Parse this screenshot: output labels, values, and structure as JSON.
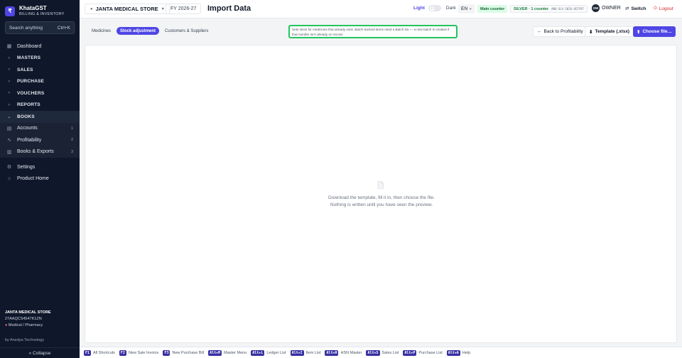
{
  "brand": {
    "logo_glyph": "₹",
    "name": "KhataGST",
    "subtitle": "BILLING & INVENTORY"
  },
  "search": {
    "placeholder": "Search anything",
    "shortcut": "Ctrl+K"
  },
  "nav": {
    "dashboard": "Dashboard",
    "masters": "MASTERS",
    "sales": "SALES",
    "purchase": "PURCHASE",
    "vouchers": "VOUCHERS",
    "reports": "REPORTS",
    "books": "BOOKS",
    "accounts": {
      "label": "Accounts",
      "count": "1"
    },
    "profitability": {
      "label": "Profitability",
      "count": "2"
    },
    "books_exports": {
      "label": "Books & Exports",
      "count": "3"
    },
    "settings": "Settings",
    "product_home": "Product Home"
  },
  "store_info": {
    "name": "JANTA MEDICAL STORE",
    "gstin": "27AAQCS4547K1ZN",
    "type": "Medical / Pharmacy"
  },
  "by_line": "by Anedya Technology",
  "collapse_label": "« Collapse",
  "topbar": {
    "store": "JANTA MEDICAL STORE",
    "fy": "FY 2026-27",
    "title": "Import Data",
    "theme_light": "Light",
    "theme_dark": "Dark",
    "lang": "EN",
    "counter_badge": "Main counter",
    "license_tier": "SILVER · 1 counter",
    "license_key": "ANO-SLV-2026-4E7F97",
    "avatar": "OW",
    "role": "OWNER",
    "switch": "Switch",
    "logout": "Logout"
  },
  "tabs": [
    "Medicines",
    "Stock adjustment",
    "Customers & Suppliers"
  ],
  "info_text": "Sets stock for medicines that already exist. Batch-tracked items need a Batch No — a new batch is created if that number isn't already on record.",
  "actions": {
    "back": "Back to Profitability",
    "template": "Template (.xlsx)",
    "choose": "Choose file…"
  },
  "empty": {
    "line1": "Download the template, fill it in, then choose the file.",
    "line2": "Nothing is written until you have seen the preview."
  },
  "shortcuts": [
    {
      "key": "F1",
      "label": "All Shortcuts"
    },
    {
      "key": "F2",
      "label": "New Sale Invoice"
    },
    {
      "key": "F3",
      "label": "New Purchase Bill"
    },
    {
      "key": "Alt+M",
      "label": "Master Menu"
    },
    {
      "key": "Alt+L",
      "label": "Ledger List"
    },
    {
      "key": "Alt+I",
      "label": "Item List"
    },
    {
      "key": "Alt+H",
      "label": "HSN Master"
    },
    {
      "key": "Alt+S",
      "label": "Sales List"
    },
    {
      "key": "Alt+P",
      "label": "Purchase List"
    },
    {
      "key": "Alt+A",
      "label": "Help"
    }
  ],
  "colors": {
    "sidebar_bg": "#0f172a",
    "accent": "#4f46e5",
    "highlight": "#22c55e",
    "danger": "#dc2626"
  }
}
